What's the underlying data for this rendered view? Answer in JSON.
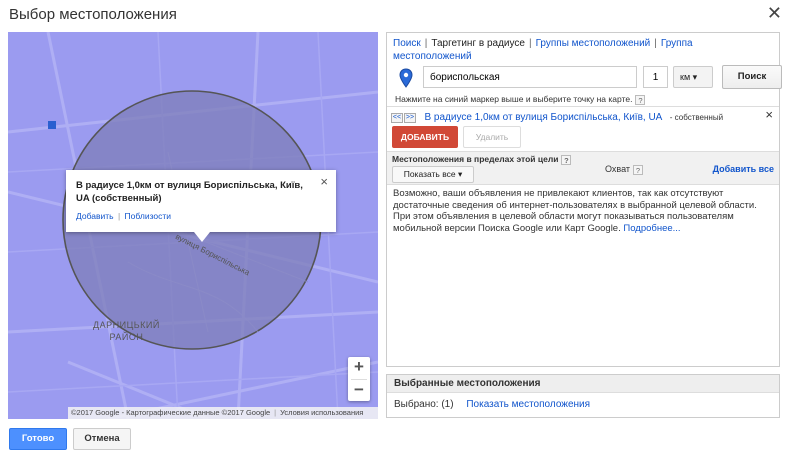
{
  "dialog": {
    "title": "Выбор местоположения",
    "close_icon": "close-icon"
  },
  "map": {
    "district_label_line1": "ДАРНИЦЬКИЙ",
    "district_label_line2": "РАЙОН",
    "street_label": "вулиця Бориспільська",
    "zoom_in": "+",
    "zoom_out": "−",
    "footer_copyright": "©2017 Google - Картографические данные ©2017 Google",
    "footer_terms": "Условия использования",
    "info_window": {
      "title": "В радиусе 1,0км от вулиця Бориспільська, Київ, UA (собственный)",
      "add_link": "Добавить",
      "separator": "|",
      "nearby_link": "Поблизости",
      "close": "×"
    },
    "circle_color": "#5a5a8f"
  },
  "panel": {
    "tabs": [
      "Поиск",
      "Таргетинг в радиусе",
      "Группы местоположений",
      "Группа местоположений"
    ],
    "tab_separator": "|",
    "search_value": "бориспольская",
    "radius_value": "1",
    "unit_label": "км",
    "search_button": "Поиск",
    "hint": "Нажмите на синий маркер выше и выберите точку на карте.",
    "help_mark": "?",
    "result": {
      "prev": "<<",
      "next": ">>",
      "title": "В радиусе 1,0км от вулиця Бориспільська, Київ, UA",
      "note": "- собственный",
      "close": "×"
    },
    "add_button": "ДОБАВИТЬ",
    "delete_button": "Удалить",
    "grid": {
      "title": "Местоположения в пределах этой цели",
      "show_all": "Показать все",
      "reach_label": "Охват",
      "add_all": "Добавить все"
    },
    "message_text": "Возможно, ваши объявления не привлекают клиентов, так как отсутствуют достаточные сведения об интернет-пользователях в выбранной целевой области. При этом объявления в целевой области могут показываться пользователям мобильной версии Поиска Google или Карт Google.",
    "more_link": "Подробнее..."
  },
  "selected": {
    "header": "Выбранные местоположения",
    "selected_label": "Выбрано: (1)",
    "show_link": "Показать местоположения"
  },
  "footer": {
    "done_button": "Готово",
    "cancel_button": "Отмена"
  },
  "colors": {
    "map_overlay": "#9b9bf0",
    "add_button": "#d14836",
    "primary_button": "#4d90fe",
    "link": "#1155cc"
  }
}
